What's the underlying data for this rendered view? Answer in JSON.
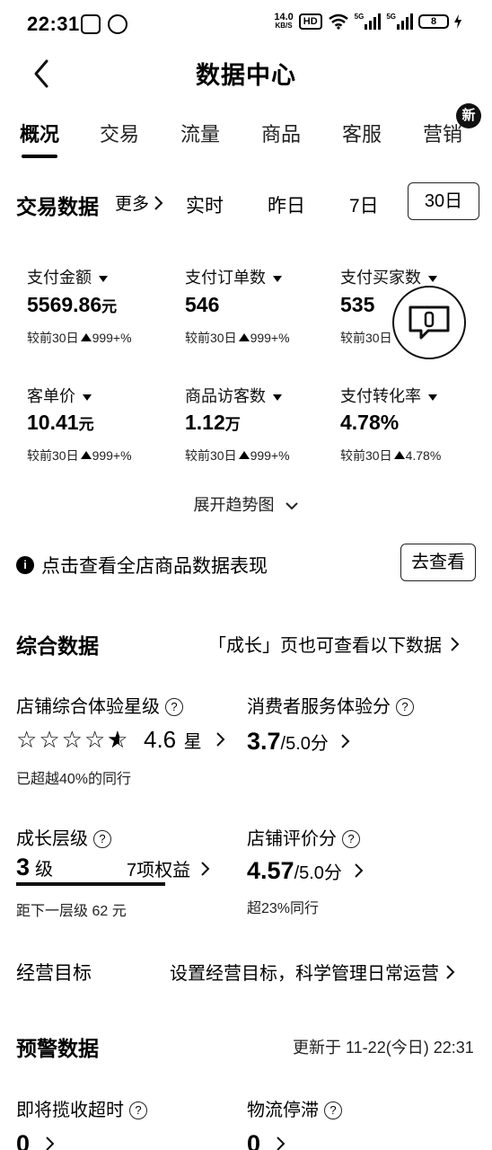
{
  "status_bar": {
    "time": "22:31",
    "speed_value": "14.0",
    "speed_unit": "KB/S",
    "hd": "HD",
    "sim1": "5G",
    "sim2": "5G",
    "battery": "8"
  },
  "header": {
    "title": "数据中心"
  },
  "tabs": [
    "概况",
    "交易",
    "流量",
    "商品",
    "客服",
    "营销"
  ],
  "tab_badge": "新",
  "trade": {
    "title": "交易数据",
    "more": "更多",
    "periods": [
      "实时",
      "昨日",
      "7日",
      "30日"
    ],
    "metrics": [
      {
        "label": "支付金额",
        "value": "5569.86",
        "unit": "元",
        "compare": "较前30日",
        "change": "999+%"
      },
      {
        "label": "支付订单数",
        "value": "546",
        "unit": "",
        "compare": "较前30日",
        "change": "999+%"
      },
      {
        "label": "支付买家数",
        "value": "535",
        "unit": "",
        "compare": "较前30日",
        "change": ""
      },
      {
        "label": "客单价",
        "value": "10.41",
        "unit": "元",
        "compare": "较前30日",
        "change": "999+%"
      },
      {
        "label": "商品访客数",
        "value": "1.12",
        "unit": "万",
        "compare": "较前30日",
        "change": "999+%"
      },
      {
        "label": "支付转化率",
        "value": "4.78%",
        "unit": "",
        "compare": "较前30日",
        "change": "4.78%"
      }
    ],
    "expand": "展开趋势图"
  },
  "tip": {
    "text": "点击查看全店商品数据表现",
    "button": "去查看"
  },
  "overall": {
    "title": "综合数据",
    "link": "「成长」页也可查看以下数据",
    "experience_label": "店铺综合体验星级",
    "rating": "4.6",
    "rating_unit": "星",
    "rating_stars": 4.6,
    "beyond": "已超越40%的同行",
    "service_label": "消费者服务体验分",
    "service_score": "3.7",
    "service_total": "/5.0分",
    "growth_label": "成长层级",
    "growth_level": "3",
    "growth_unit": "级",
    "growth_rights": "7项权益",
    "growth_progress": 1.0,
    "growth_next": "距下一层级 62 元",
    "review_label": "店铺评价分",
    "review_score": "4.57",
    "review_total": "/5.0分",
    "review_beyond": "超23%同行"
  },
  "goal": {
    "label": "经营目标",
    "link": "设置经营目标，科学管理日常运营"
  },
  "warning": {
    "title": "预警数据",
    "updated": "更新于 11-22(今日) 22:31",
    "items": [
      {
        "label": "即将揽收超时",
        "value": "0"
      },
      {
        "label": "物流停滞",
        "value": "0"
      }
    ]
  }
}
